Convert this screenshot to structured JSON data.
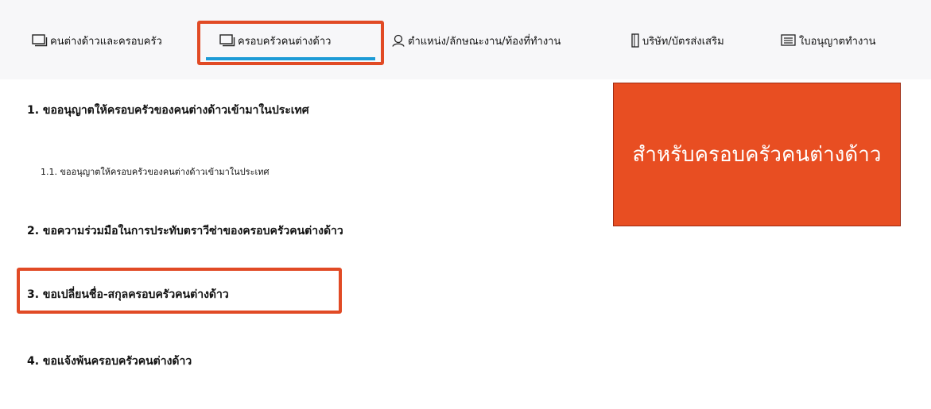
{
  "tabs": [
    {
      "label": "คนต่างด้าวและครอบครัว",
      "icon": "documents-icon"
    },
    {
      "label": "ครอบครัวคนต่างด้าว",
      "icon": "documents-icon",
      "active": true
    },
    {
      "label": "ตำแหน่ง/ลักษณะงาน/ท้องที่ทำงาน",
      "icon": "person-icon"
    },
    {
      "label": "บริษัท/บัตรส่งเสริม",
      "icon": "card-icon"
    },
    {
      "label": "ใบอนุญาตทำงาน",
      "icon": "list-icon"
    }
  ],
  "menu": {
    "item1": "1. ขออนุญาตให้ครอบครัวของคนต่างด้าวเข้ามาในประเทศ",
    "item1_1": "1.1. ขออนุญาตให้ครอบครัวของคนต่างด้าวเข้ามาในประเทศ",
    "item2": "2. ขอความร่วมมือในการประทับตราวีซ่าของครอบครัวคนต่างด้าว",
    "item3": "3. ขอเปลี่ยนชื่อ-สกุลครอบครัวคนต่างด้าว",
    "item4": "4. ขอแจ้งพ้นครอบครัวคนต่างด้าว"
  },
  "callout": {
    "text": "สำหรับครอบครัวคนต่างด้าว"
  },
  "colors": {
    "accent_blue": "#1d9bd6",
    "highlight_red": "#e14a25",
    "callout_orange": "#e84e22"
  }
}
